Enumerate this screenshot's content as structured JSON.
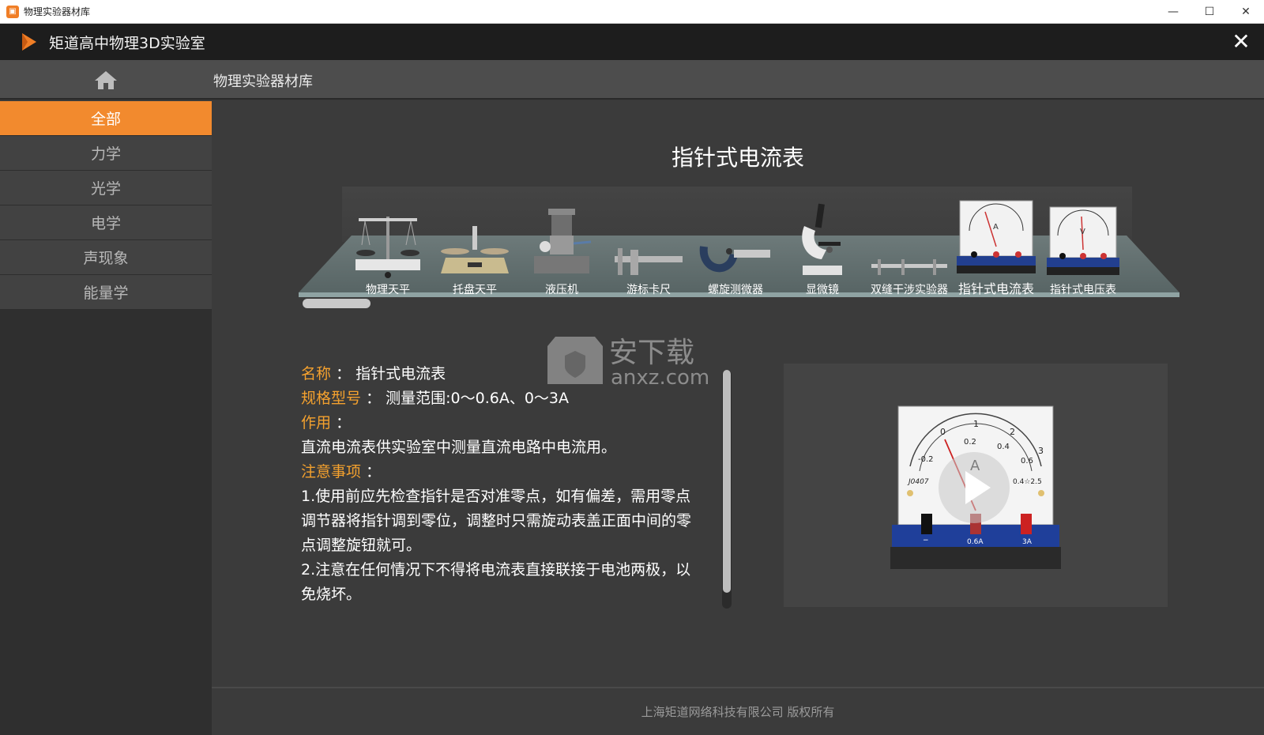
{
  "window": {
    "title": "物理实验器材库",
    "minimize": "—",
    "maximize": "☐",
    "close": "✕"
  },
  "header": {
    "title": "矩道高中物理3D实验室",
    "close": "✕"
  },
  "toolbar": {
    "breadcrumb": "物理实验器材库"
  },
  "sidebar": {
    "items": [
      {
        "label": "全部",
        "active": true
      },
      {
        "label": "力学"
      },
      {
        "label": "光学"
      },
      {
        "label": "电学"
      },
      {
        "label": "声现象"
      },
      {
        "label": "能量学"
      }
    ]
  },
  "main": {
    "title": "指针式电流表",
    "equipment": [
      {
        "label": "物理天平",
        "icon": "balance-icon"
      },
      {
        "label": "托盘天平",
        "icon": "tray-balance-icon"
      },
      {
        "label": "液压机",
        "icon": "hydraulic-press-icon"
      },
      {
        "label": "游标卡尺",
        "icon": "vernier-caliper-icon"
      },
      {
        "label": "螺旋测微器",
        "icon": "micrometer-icon"
      },
      {
        "label": "显微镜",
        "icon": "microscope-icon"
      },
      {
        "label": "双缝干涉实验器",
        "icon": "double-slit-icon"
      },
      {
        "label": "指针式电流表",
        "icon": "ammeter-icon",
        "selected": true
      },
      {
        "label": "指针式电压表",
        "icon": "voltmeter-icon"
      }
    ],
    "info": {
      "name_label": "名称",
      "name_value": "指针式电流表",
      "spec_label": "规格型号",
      "spec_value": "测量范围:0～0.6A、0～3A",
      "use_label": "作用",
      "use_value": "直流电流表供实验室中测量直流电路中电流用。",
      "note_label": "注意事项",
      "note_1": "1.使用前应先检查指针是否对准零点，如有偏差，需用零点调节器将指针调到零位，调整时只需旋动表盖正面中间的零点调整旋钮就可。",
      "note_2": "2.注意在任何情况下不得将电流表直接联接于电池两极，以免烧坏。",
      "colon": "："
    },
    "video": {
      "meter_symbol": "A",
      "scale_top": [
        "0",
        "1",
        "2",
        "3"
      ],
      "scale_bottom": [
        "-0.2",
        "0.2",
        "0.4",
        "0.6"
      ],
      "model": "J0407",
      "accuracy": "0.4☆2.5",
      "terminals": [
        "−",
        "0.6A",
        "3A"
      ]
    }
  },
  "watermark": {
    "brand": "安下载",
    "domain": "anxz.com"
  },
  "footer": {
    "text": "上海矩道网络科技有限公司 版权所有"
  },
  "colors": {
    "accent": "#f28a2e",
    "label": "#f4a12e"
  }
}
